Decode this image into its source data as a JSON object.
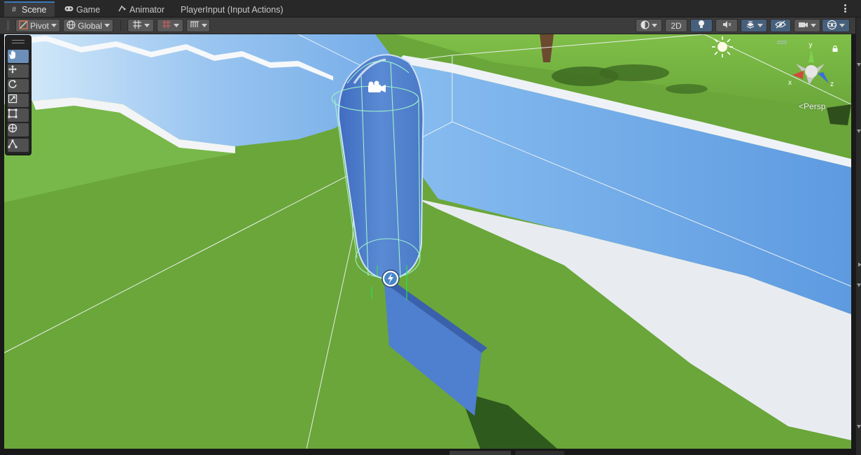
{
  "tabs": [
    {
      "label": "Scene",
      "icon": "grid-icon",
      "active": true
    },
    {
      "label": "Game",
      "icon": "gamepad-icon",
      "active": false
    },
    {
      "label": "Animator",
      "icon": "animator-icon",
      "active": false
    },
    {
      "label": "PlayerInput (Input Actions)",
      "icon": "",
      "active": false
    }
  ],
  "toolbar": {
    "pivot_label": "Pivot",
    "global_label": "Global",
    "two_d_label": "2D",
    "icons": [
      "pivot-icon",
      "globe-icon",
      "grid-snap-icon",
      "snap-increment-icon",
      "ruler-icon",
      "shading-mode-icon",
      "lighting-icon",
      "audio-mute-icon",
      "effects-icon",
      "visibility-icon",
      "camera-icon",
      "gizmos-icon"
    ]
  },
  "tools": [
    {
      "name": "hand-tool",
      "icon": "hand-icon",
      "active": true
    },
    {
      "name": "move-tool",
      "icon": "move-icon",
      "active": false
    },
    {
      "name": "rotate-tool",
      "icon": "rotate-icon",
      "active": false
    },
    {
      "name": "scale-tool",
      "icon": "scale-icon",
      "active": false
    },
    {
      "name": "rect-tool",
      "icon": "rect-icon",
      "active": false
    },
    {
      "name": "transform-tool",
      "icon": "transform-icon",
      "active": false
    },
    {
      "name": "custom-tool",
      "icon": "custom-tool-icon",
      "active": false
    }
  ],
  "scene_gizmo": {
    "projection_label": "Persp",
    "axis_labels": {
      "x": "x",
      "y": "y",
      "z": "z"
    }
  },
  "colors": {
    "accent": "#3a79bb",
    "grass": "#6aa63a",
    "water": "#6aa8e4",
    "player": "#4f7fcf",
    "collider": "#8ff0c8"
  }
}
